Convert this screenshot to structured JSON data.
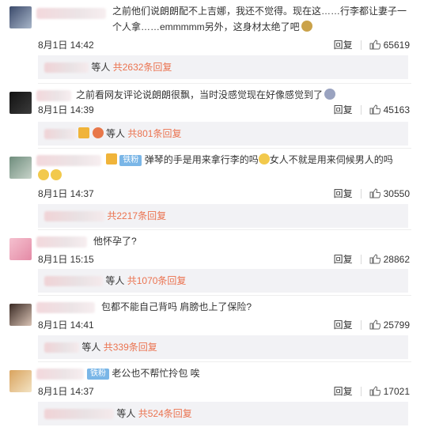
{
  "labels": {
    "reply": "回复",
    "people_suffix": "等人",
    "total_prefix": "共",
    "replies_suffix": "条回复"
  },
  "badge_text": "铁粉",
  "comments": [
    {
      "text": "之前他们说朗朗配不上吉娜，我还不觉得。现在这……行李都让妻子一个人拿……emmmmm另外，这身材太绝了吧",
      "time": "8月1日 14:42",
      "likes": "65619",
      "reply_count": "2632"
    },
    {
      "text": "之前看网友评论说朗朗很飘，当时没感觉现在好像感觉到了",
      "time": "8月1日 14:39",
      "likes": "45163",
      "reply_count": "801"
    },
    {
      "text": "弹琴的手是用来拿行李的吗",
      "text2": "女人不就是用来伺候男人的吗",
      "time": "8月1日 14:37",
      "likes": "30550",
      "reply_count": "2217"
    },
    {
      "text": "他怀孕了?",
      "time": "8月1日 15:15",
      "likes": "28862",
      "reply_count": "1070"
    },
    {
      "text": "包都不能自己背吗 肩膀也上了保险?",
      "time": "8月1日 14:41",
      "likes": "25799",
      "reply_count": "339"
    },
    {
      "text": "老公也不帮忙拎包 唉",
      "time": "8月1日 14:37",
      "likes": "17021",
      "reply_count": "524"
    }
  ]
}
